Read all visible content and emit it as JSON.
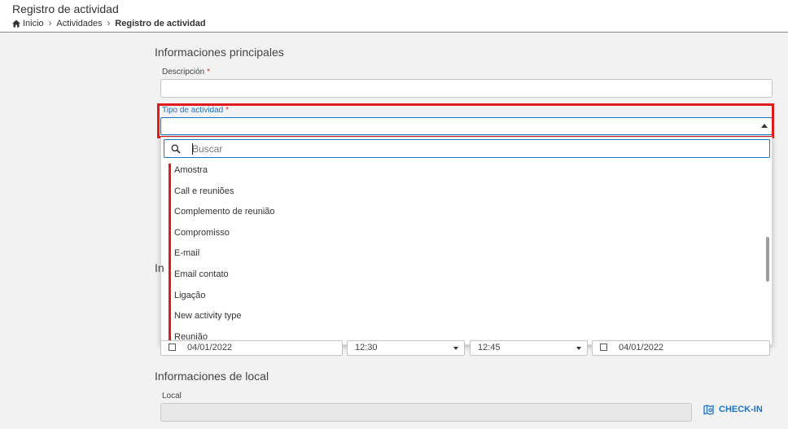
{
  "header": {
    "title": "Registro de actividad",
    "breadcrumb": {
      "home": "Inicio",
      "activities": "Actividades",
      "current": "Registro de actividad"
    }
  },
  "form": {
    "main_section": "Informaciones principales",
    "description_label": "Descripción",
    "description_value": "",
    "activity_type_label": "Tipo de actividad",
    "required_marker": "*",
    "search_placeholder": "Buscar",
    "options": [
      "Amostra",
      "Call e reuniões",
      "Complemento de reunião",
      "Compromisso",
      "E-mail",
      "Email contato",
      "Ligação",
      "New activity type",
      "Reunião"
    ],
    "partial_heading": "In",
    "start_date": "04/01/2022",
    "start_time": "12:30",
    "end_time": "12:45",
    "end_date": "04/01/2022",
    "location_section": "Informaciones de local",
    "local_label": "Local",
    "local_value": "",
    "checkin_label": "CHECK-IN"
  },
  "colors": {
    "accent": "#1a73c8",
    "highlight": "#e01b1b",
    "required": "#d32f2f"
  }
}
